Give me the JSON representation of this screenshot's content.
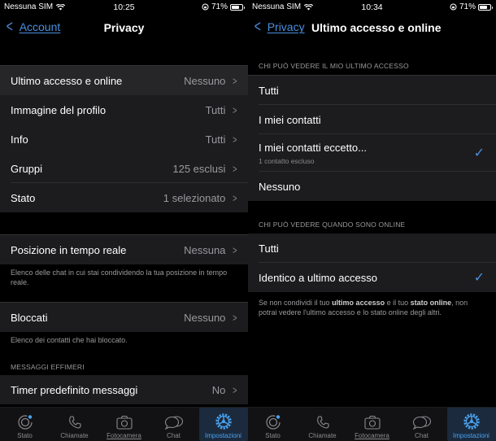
{
  "left": {
    "status": {
      "carrier": "Nessuna SIM",
      "time": "10:25",
      "battery": "71%"
    },
    "nav": {
      "back_label": "Account",
      "title": "Privacy"
    },
    "group1": [
      {
        "label": "Ultimo accesso e online",
        "value": "Nessuno"
      },
      {
        "label": "Immagine del profilo",
        "value": "Tutti"
      },
      {
        "label": "Info",
        "value": "Tutti"
      },
      {
        "label": "Gruppi",
        "value": "125 esclusi"
      },
      {
        "label": "Stato",
        "value": "1 selezionato"
      }
    ],
    "live_location": {
      "label": "Posizione in tempo reale",
      "value": "Nessuna",
      "footnote": "Elenco delle chat in cui stai condividendo la tua posizione in tempo reale."
    },
    "blocked": {
      "label": "Bloccati",
      "value": "Nessuno",
      "footnote": "Elenco dei contatti che hai bloccato."
    },
    "ephemeral": {
      "header": "MESSAGGI EFFIMERI",
      "label": "Timer predefinito messaggi",
      "value": "No"
    }
  },
  "right": {
    "status": {
      "carrier": "Nessuna SIM",
      "time": "10:34",
      "battery": "71%"
    },
    "nav": {
      "back_label": "Privacy",
      "title": "Ultimo accesso e online"
    },
    "last_seen": {
      "header": "CHI PUÒ VEDERE IL MIO ULTIMO ACCESSO",
      "options": [
        {
          "label": "Tutti",
          "selected": false
        },
        {
          "label": "I miei contatti",
          "selected": false
        },
        {
          "label": "I miei contatti eccetto...",
          "sub": "1 contatto escluso",
          "selected": true
        },
        {
          "label": "Nessuno",
          "selected": false
        }
      ]
    },
    "online": {
      "header": "CHI PUÒ VEDERE QUANDO SONO ONLINE",
      "options": [
        {
          "label": "Tutti",
          "selected": false
        },
        {
          "label": "Identico a ultimo accesso",
          "selected": true
        }
      ],
      "footnote_parts": [
        "Se non condividi il tuo ",
        "ultimo accesso",
        " e il tuo ",
        "stato online",
        ", non potrai vedere l'ultimo accesso e lo stato online degli altri."
      ]
    }
  },
  "tabbar": [
    {
      "label": "Stato",
      "icon": "status-icon"
    },
    {
      "label": "Chiamate",
      "icon": "phone-icon"
    },
    {
      "label": "Fotocamera",
      "icon": "camera-icon"
    },
    {
      "label": "Chat",
      "icon": "chat-icon"
    },
    {
      "label": "Impostazioni",
      "icon": "settings-icon",
      "active": true
    }
  ],
  "colors": {
    "accent": "#4a8fe0",
    "row_bg": "#1c1c1e",
    "active_tab_bg": "#1b2a3d"
  }
}
